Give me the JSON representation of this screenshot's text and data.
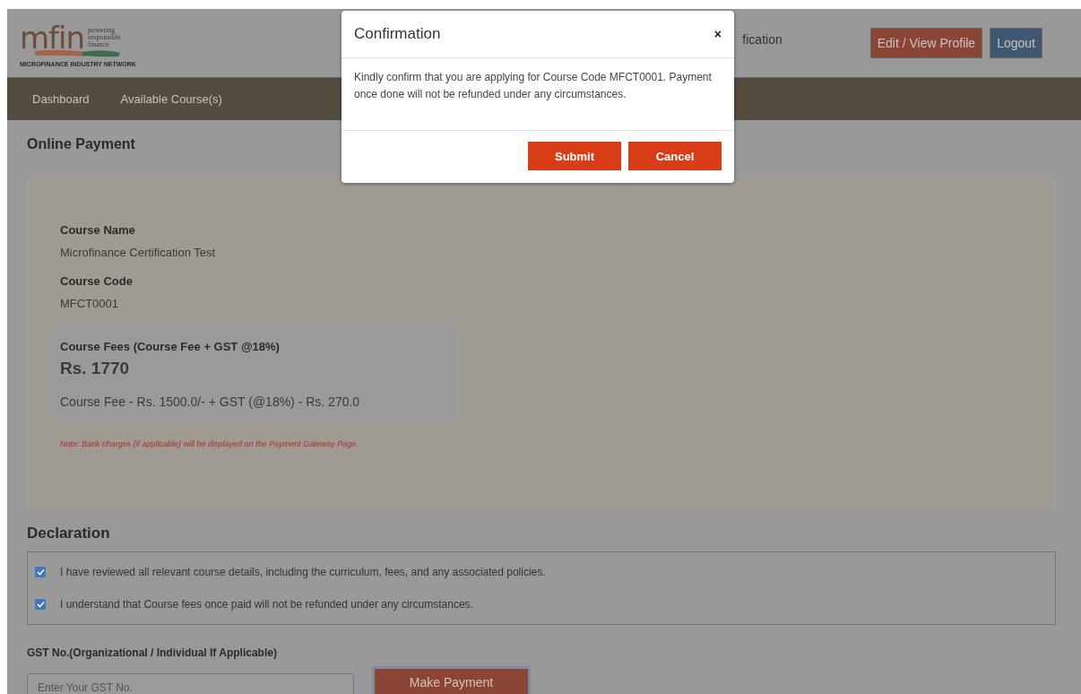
{
  "header": {
    "logo": {
      "wordmark": "mfin",
      "tagline": [
        "powering",
        "responsible",
        "finance"
      ],
      "full_name": "MICROFINANCE INDUSTRY NETWORK"
    },
    "menu_text": "fication",
    "buttons": [
      {
        "label": "Edit / View Profile",
        "kind": "primary"
      },
      {
        "label": "Logout",
        "kind": "secondary"
      }
    ]
  },
  "nav": {
    "items": [
      {
        "label": "Dashboard"
      },
      {
        "label": "Available Course(s)"
      }
    ]
  },
  "page": {
    "title": "Online Payment",
    "fields": [
      {
        "label": "Course Name",
        "value": "Microfinance Certification Test"
      },
      {
        "label": "Course Code",
        "value": "MFCT0001"
      }
    ],
    "fees": {
      "label": "Course Fees (Course Fee + GST @18%)",
      "amount": "Rs. 1770",
      "breakdown": "Course Fee - Rs. 1500.0/- + GST (@18%) - Rs. 270.0"
    },
    "note": "Note: Bank charges (if applicable) will be displayed on the Payment Gateway Page.",
    "declaration": {
      "title": "Declaration",
      "items": [
        {
          "text": "I have reviewed all relevant course details, including the curriculum, fees, and any associated policies.",
          "checked": true
        },
        {
          "text": "I understand that Course fees once paid will not be refunded under any circumstances.",
          "checked": true
        }
      ]
    },
    "gst": {
      "label": "GST No.(Organizational / Individual If Applicable)",
      "placeholder": "Enter Your GST No."
    },
    "pay_button": "Make Payment"
  },
  "modal": {
    "title": "Confirmation",
    "close": "×",
    "message": "Kindly confirm that you are applying for Course Code MFCT0001. Payment once done will not be refunded under any circumstances.",
    "buttons": [
      {
        "label": "Submit"
      },
      {
        "label": "Cancel"
      }
    ]
  }
}
